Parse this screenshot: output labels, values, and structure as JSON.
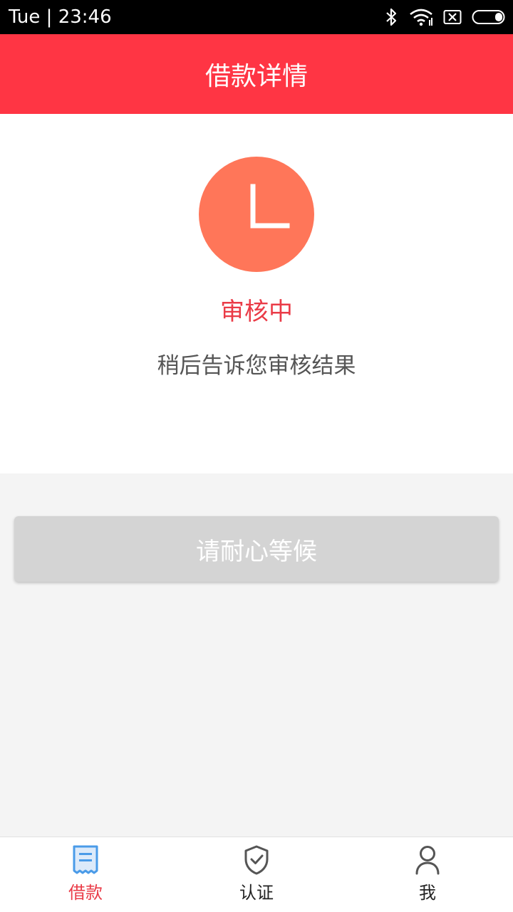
{
  "status_bar": {
    "time": "Tue | 23:46",
    "icons": [
      "bluetooth-icon",
      "wifi-icon",
      "no-sim-icon",
      "battery-icon"
    ]
  },
  "header": {
    "title": "借款详情"
  },
  "status_card": {
    "icon": "clock-icon",
    "status": "审核中",
    "description": "稍后告诉您审核结果"
  },
  "action": {
    "button_label": "请耐心等候"
  },
  "bottom_nav": {
    "items": [
      {
        "label": "借款",
        "icon": "loan-receipt-icon",
        "active": true
      },
      {
        "label": "认证",
        "icon": "shield-check-icon",
        "active": false
      },
      {
        "label": "我",
        "icon": "user-icon",
        "active": false
      }
    ]
  },
  "colors": {
    "header": "#ff3544",
    "clock_circle": "#ff7659",
    "status_text": "#ea3b47",
    "active_icon": "#4a9be8",
    "button_disabled": "#d4d4d4"
  }
}
